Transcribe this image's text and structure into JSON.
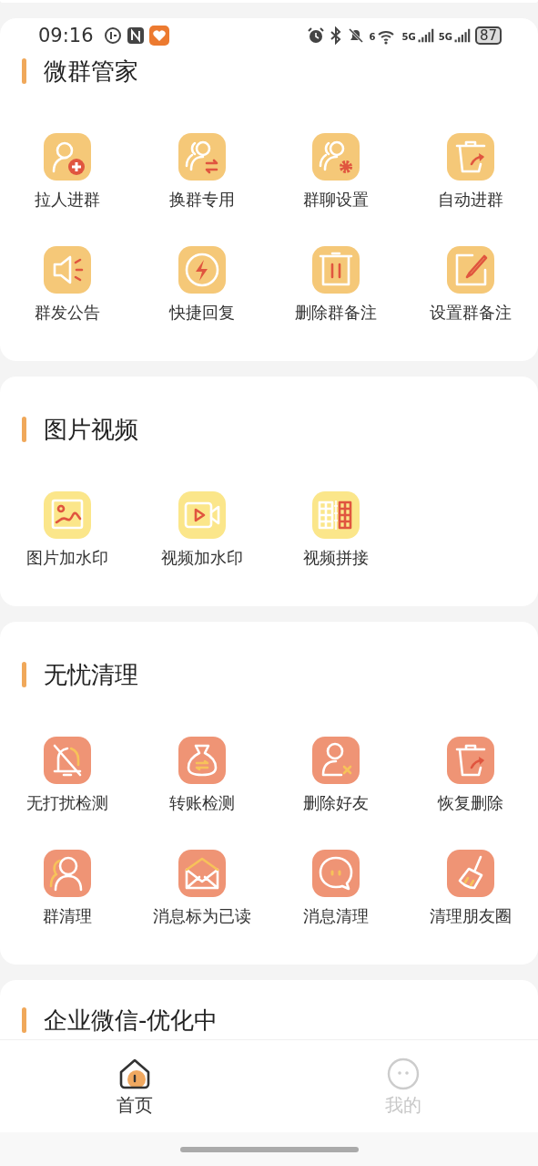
{
  "status_bar": {
    "time": "09:16",
    "wifi_standard": "6",
    "networks": [
      "5G",
      "5G"
    ],
    "battery": "87"
  },
  "sections": [
    {
      "title": "微群管家",
      "color": "#f5c878",
      "items": [
        {
          "label": "拉人进群",
          "kind": "person-add"
        },
        {
          "label": "换群专用",
          "kind": "group-swap"
        },
        {
          "label": "群聊设置",
          "kind": "group-gear"
        },
        {
          "label": "自动进群",
          "kind": "bin-arrow"
        },
        {
          "label": "群发公告",
          "kind": "speaker"
        },
        {
          "label": "快捷回复",
          "kind": "bolt"
        },
        {
          "label": "删除群备注",
          "kind": "bin"
        },
        {
          "label": "设置群备注",
          "kind": "pencil"
        }
      ]
    },
    {
      "title": "图片视频",
      "color": "#fbe68a",
      "items": [
        {
          "label": "图片加水印",
          "kind": "image"
        },
        {
          "label": "视频加水印",
          "kind": "video"
        },
        {
          "label": "视频拼接",
          "kind": "film"
        }
      ]
    },
    {
      "title": "无忧清理",
      "color": "#ef9475",
      "items": [
        {
          "label": "无打扰检测",
          "kind": "bell-off"
        },
        {
          "label": "转账检测",
          "kind": "money-bag"
        },
        {
          "label": "删除好友",
          "kind": "person-x"
        },
        {
          "label": "恢复删除",
          "kind": "bin-arrow"
        },
        {
          "label": "群清理",
          "kind": "group"
        },
        {
          "label": "消息标为已读",
          "kind": "envelope"
        },
        {
          "label": "消息清理",
          "kind": "chat"
        },
        {
          "label": "清理朋友圈",
          "kind": "brush"
        }
      ]
    },
    {
      "title": "企业微信-优化中"
    }
  ],
  "tabs": [
    {
      "label": "首页",
      "kind": "home",
      "selected": true
    },
    {
      "label": "我的",
      "kind": "face",
      "selected": false
    }
  ]
}
